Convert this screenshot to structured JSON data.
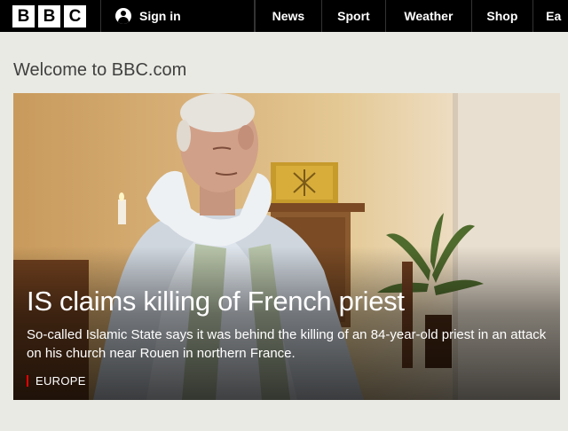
{
  "header": {
    "logo_letters": [
      "B",
      "B",
      "C"
    ],
    "signin_label": "Sign in",
    "nav": [
      {
        "label": "News"
      },
      {
        "label": "Sport"
      },
      {
        "label": "Weather"
      },
      {
        "label": "Shop"
      },
      {
        "label": "Ea"
      }
    ]
  },
  "page": {
    "welcome": "Welcome to BBC.com"
  },
  "hero": {
    "headline": "IS claims killing of French priest",
    "summary": "So-called Islamic State says it was behind the killing of an 84-year-old priest in an attack on his church near Rouen in northern France.",
    "tag": "EUROPE",
    "tag_color": "#ee0000"
  },
  "colors": {
    "topbar": "#000000",
    "page_bg": "#eaeae4"
  }
}
